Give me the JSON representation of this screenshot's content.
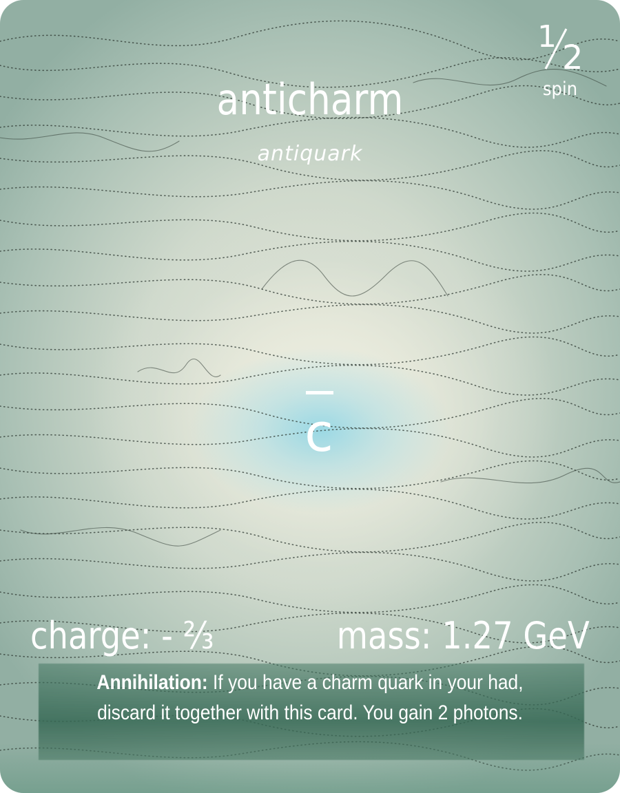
{
  "card": {
    "name": "anticharm",
    "family": "antiquark",
    "symbol": "c",
    "spin": {
      "numerator": "1",
      "denominator": "2",
      "label": "spin"
    },
    "charge": "charge: - ⅔",
    "mass": "mass: 1.27 GeV",
    "ability": {
      "title": "Annihilation:",
      "line1": "If you have a charm quark in your had,",
      "line2": "discard it together with this card. You gain 2 photons."
    }
  },
  "colors": {
    "text": "#ffffff",
    "center_glow": "#96d7e4",
    "background": "#cfd9cc",
    "panel": "#37695a",
    "trace_lines": "#2f3a33"
  }
}
